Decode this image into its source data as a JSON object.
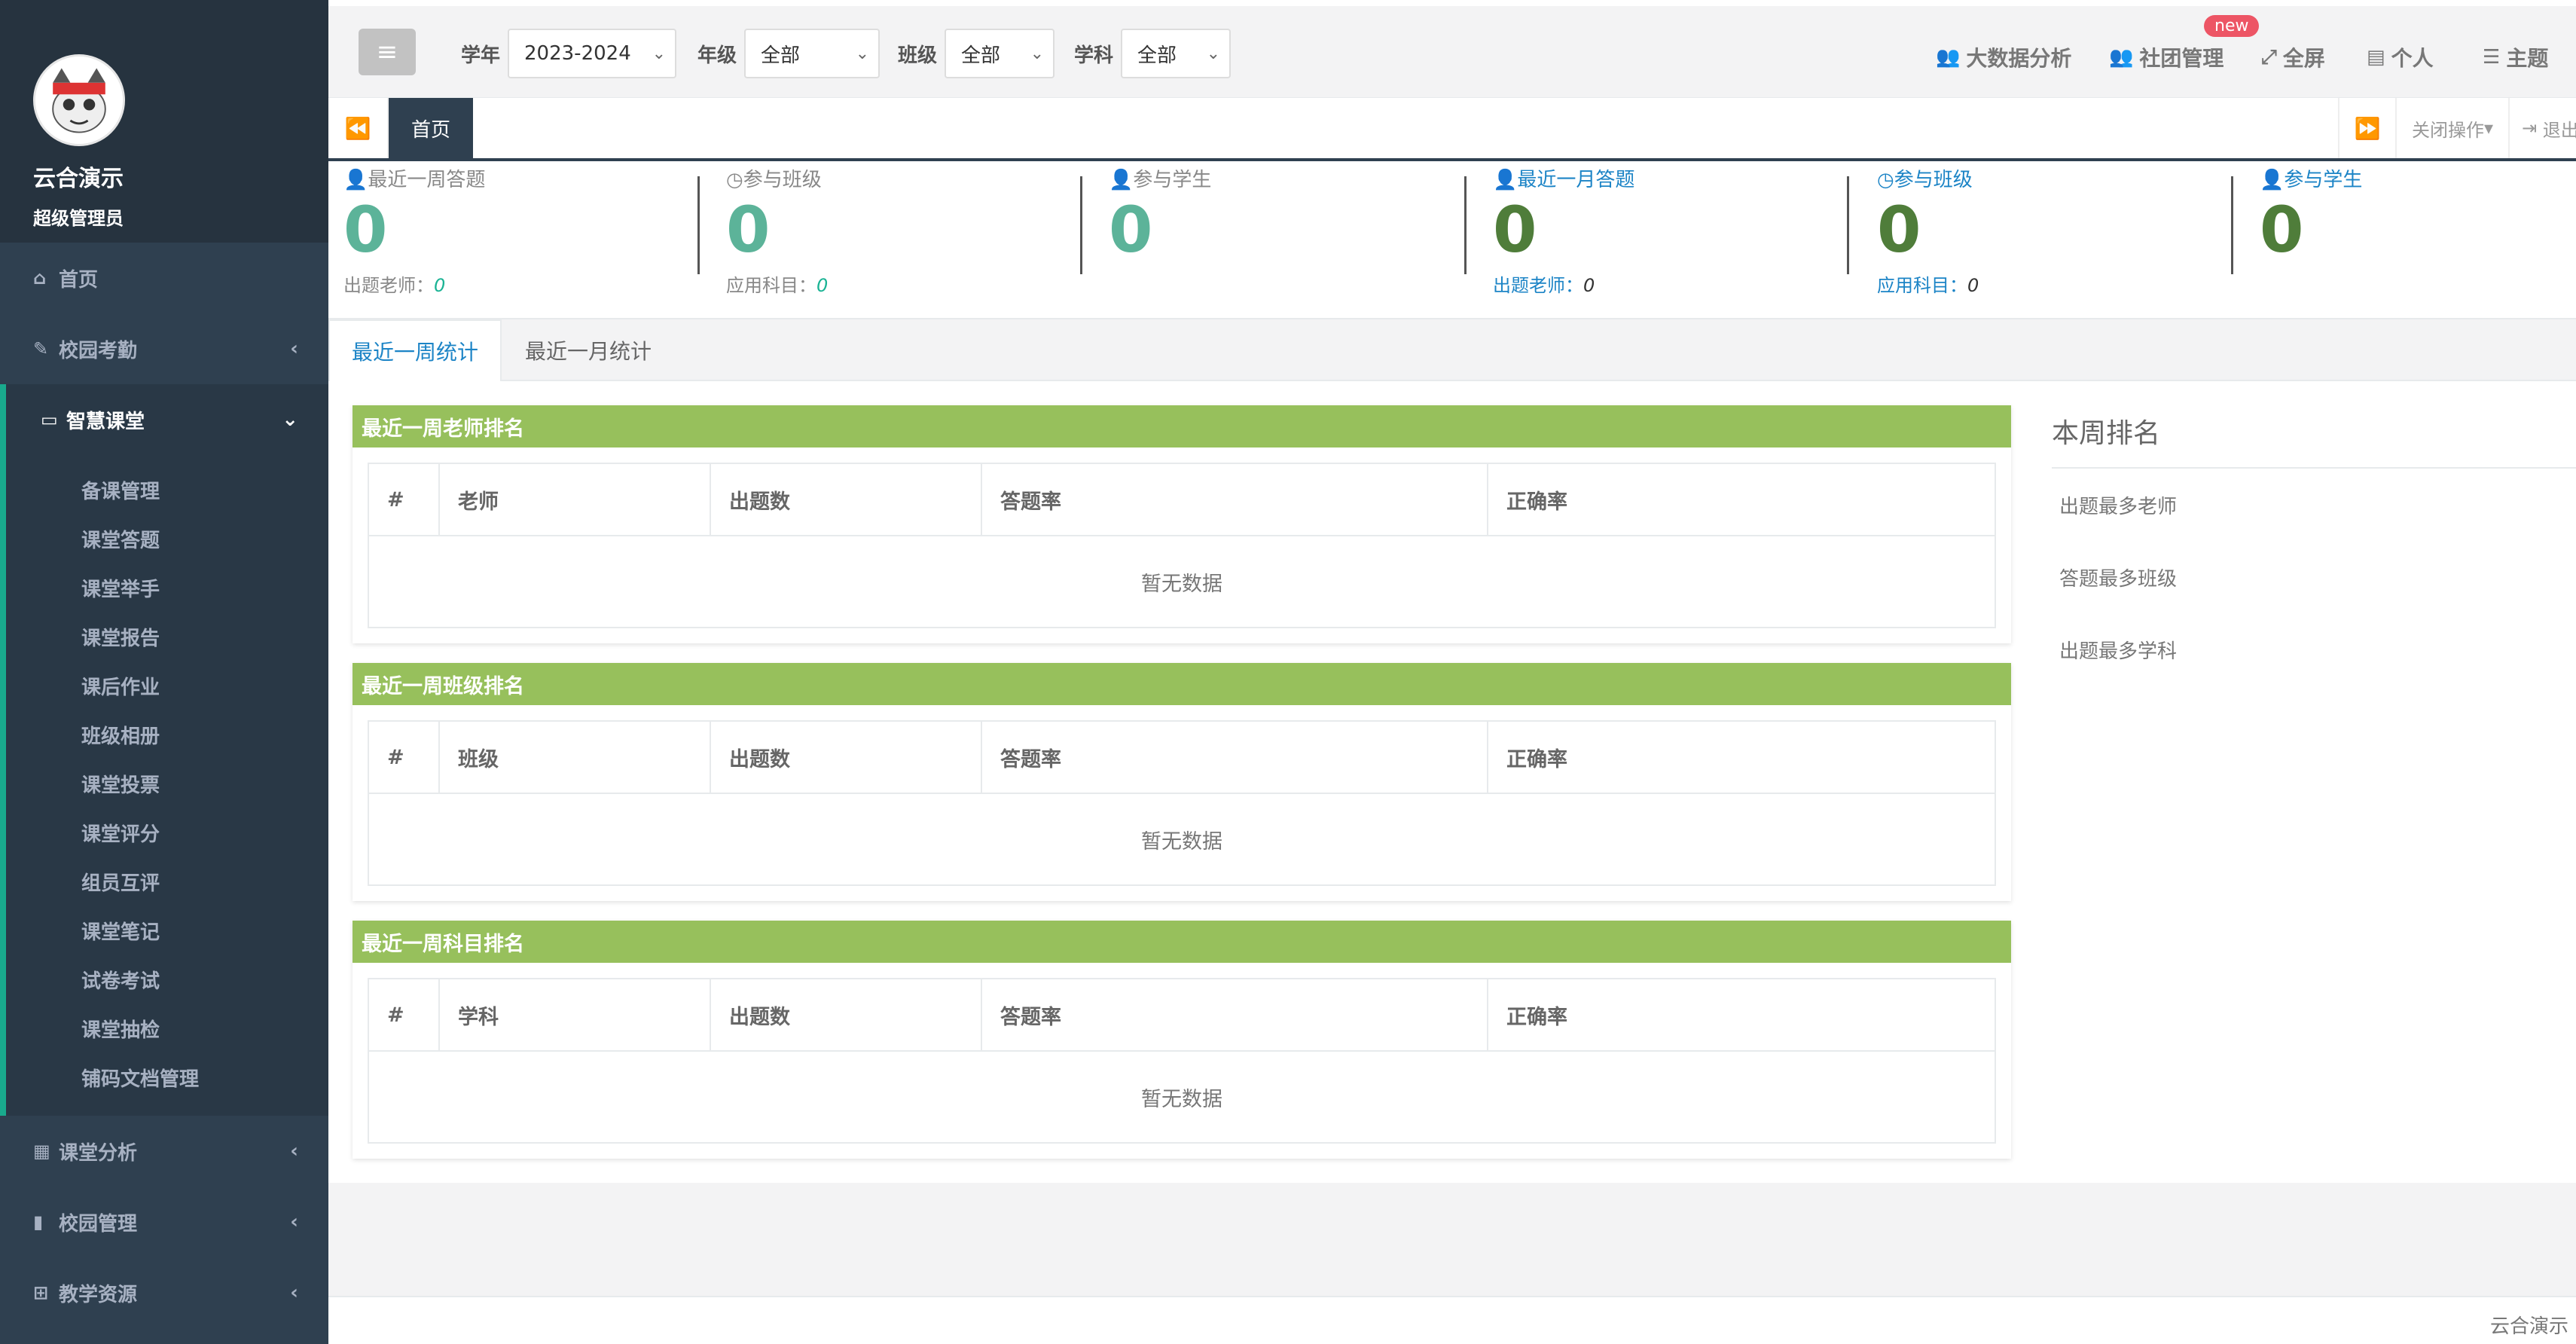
{
  "user": {
    "name": "云合演示",
    "role": "超级管理员"
  },
  "nav": {
    "home": "首页",
    "campus_attendance": "校园考勤",
    "smart_class": "智慧课堂",
    "smart_class_items": [
      "备课管理",
      "课堂答题",
      "课堂举手",
      "课堂报告",
      "课后作业",
      "班级相册",
      "课堂投票",
      "课堂评分",
      "组员互评",
      "课堂笔记",
      "试卷考试",
      "课堂抽检",
      "铺码文档管理"
    ],
    "class_analysis": "课堂分析",
    "campus_management": "校园管理",
    "teaching_resources": "教学资源"
  },
  "filters": {
    "year_label": "学年",
    "year_value": "2023-2024",
    "grade_label": "年级",
    "grade_value": "全部",
    "class_label": "班级",
    "class_value": "全部",
    "subject_label": "学科",
    "subject_value": "全部"
  },
  "topbar": {
    "big_data": "大数据分析",
    "club": "社团管理",
    "new_badge": "new",
    "fullscreen": "全屏",
    "personal": "个人",
    "theme": "主题"
  },
  "tabs": {
    "home": "首页",
    "close_ops": "关闭操作",
    "exit": "退出"
  },
  "stats": {
    "week_answers_label": "最近一周答题",
    "week_answers": "0",
    "week_teachers_label": "出题老师：",
    "week_teachers": "0",
    "week_classes_label": "参与班级",
    "week_classes": "0",
    "week_subjects_label": "应用科目：",
    "week_subjects": "0",
    "week_students_label": "参与学生",
    "week_students": "0",
    "month_answers_label": "最近一月答题",
    "month_answers": "0",
    "month_teachers_label": "出题老师：",
    "month_teachers": "0",
    "month_classes_label": "参与班级",
    "month_classes": "0",
    "month_subjects_label": "应用科目：",
    "month_subjects": "0",
    "month_students_label": "参与学生",
    "month_students": "0"
  },
  "main_tabs": {
    "week": "最近一周统计",
    "month": "最近一月统计"
  },
  "panels": {
    "teacher": {
      "title": "最近一周老师排名",
      "cols": [
        "#",
        "老师",
        "出题数",
        "答题率",
        "正确率"
      ]
    },
    "class": {
      "title": "最近一周班级排名",
      "cols": [
        "#",
        "班级",
        "出题数",
        "答题率",
        "正确率"
      ]
    },
    "subject": {
      "title": "最近一周科目排名",
      "cols": [
        "#",
        "学科",
        "出题数",
        "答题率",
        "正确率"
      ]
    },
    "empty": "暂无数据"
  },
  "ranking": {
    "title": "本周排名",
    "items": [
      "出题最多老师",
      "答题最多班级",
      "出题最多学科"
    ]
  },
  "footer": {
    "text": "云合演示"
  }
}
